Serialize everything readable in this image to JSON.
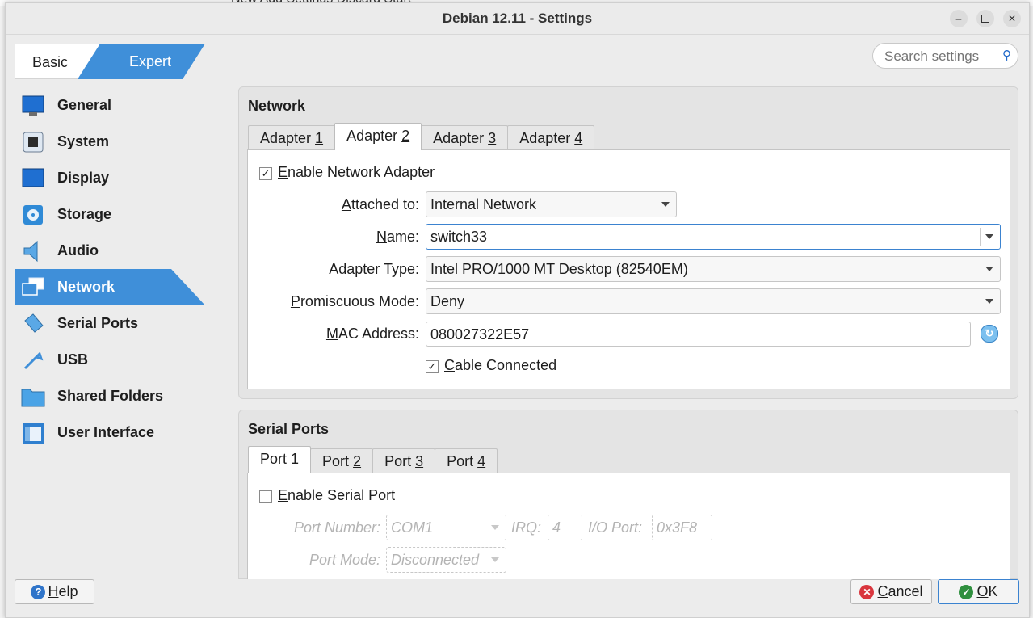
{
  "background_app": {
    "toolbar_text": "New    Add    Settings    Discard    Start"
  },
  "window": {
    "title": "Debian 12.11 - Settings"
  },
  "mode": {
    "basic": "Basic",
    "expert": "Expert"
  },
  "search": {
    "placeholder": "Search settings",
    "icon": "search-icon"
  },
  "sidebar": {
    "items": [
      {
        "label": "General",
        "icon": "general-icon"
      },
      {
        "label": "System",
        "icon": "chip-icon"
      },
      {
        "label": "Display",
        "icon": "monitor-icon"
      },
      {
        "label": "Storage",
        "icon": "disk-icon"
      },
      {
        "label": "Audio",
        "icon": "speaker-icon"
      },
      {
        "label": "Network",
        "icon": "network-icon",
        "active": true
      },
      {
        "label": "Serial Ports",
        "icon": "serial-port-icon"
      },
      {
        "label": "USB",
        "icon": "usb-icon"
      },
      {
        "label": "Shared Folders",
        "icon": "folder-icon"
      },
      {
        "label": "User Interface",
        "icon": "user-interface-icon"
      }
    ]
  },
  "network": {
    "title": "Network",
    "tabs": [
      {
        "prefix": "Adapter ",
        "key": "1"
      },
      {
        "prefix": "Adapter ",
        "key": "2",
        "active": true
      },
      {
        "prefix": "Adapter ",
        "key": "3"
      },
      {
        "prefix": "Adapter ",
        "key": "4"
      }
    ],
    "enable": {
      "pre": "",
      "key": "E",
      "post": "nable Network Adapter",
      "checked": true
    },
    "attached": {
      "key": "A",
      "post": "ttached to:",
      "value": "Internal Network"
    },
    "name": {
      "key": "N",
      "post": "ame:",
      "value": "switch33"
    },
    "adapter_type": {
      "pre": "Adapter ",
      "key": "T",
      "post": "ype:",
      "value": "Intel PRO/1000 MT Desktop (82540EM)"
    },
    "promiscuous": {
      "key": "P",
      "post": "romiscuous Mode:",
      "value": "Deny"
    },
    "mac": {
      "key": "M",
      "post": "AC Address:",
      "value": "080027322E57"
    },
    "cable": {
      "key": "C",
      "post": "able Connected",
      "checked": true
    }
  },
  "serial": {
    "title": "Serial Ports",
    "tabs": [
      {
        "prefix": "Port ",
        "key": "1",
        "active": true
      },
      {
        "prefix": "Port ",
        "key": "2"
      },
      {
        "prefix": "Port ",
        "key": "3"
      },
      {
        "prefix": "Port ",
        "key": "4"
      }
    ],
    "enable": {
      "key": "E",
      "post": "nable Serial Port",
      "checked": false
    },
    "port_number_label": "Port Number:",
    "port_number_value": "COM1",
    "irq_label": "IRQ:",
    "irq_value": "4",
    "io_label": "I/O Port:",
    "io_value": "0x3F8",
    "port_mode_label": "Port Mode:",
    "port_mode_value": "Disconnected"
  },
  "buttons": {
    "help": {
      "key": "H",
      "post": "elp"
    },
    "cancel": {
      "key": "C",
      "post": "ancel"
    },
    "ok": {
      "key": "O",
      "post": "K"
    }
  },
  "colors": {
    "accent": "#3f8fd9",
    "focus": "#3b83d0",
    "cancel_icon": "#d9363e",
    "ok_icon": "#2f8f3e"
  }
}
